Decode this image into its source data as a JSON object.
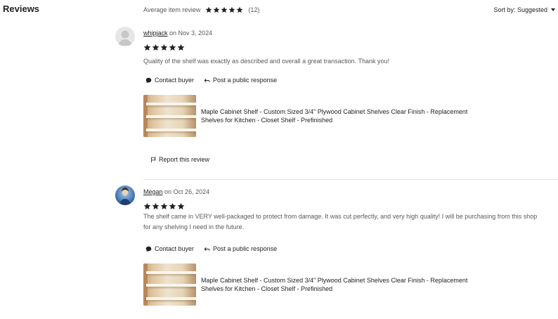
{
  "section": {
    "title": "Reviews"
  },
  "summary": {
    "label": "Average item review",
    "rating": 5,
    "count_text": "(12)",
    "star_color": "#222222"
  },
  "sort": {
    "label": "Sort by: Suggested",
    "icon": "caret-down-icon"
  },
  "reviews": [
    {
      "username": "whipjack",
      "date_text": "on Nov 3, 2024",
      "rating": 5,
      "text": "Quality of the shelf was exactly as described and overall a great transaction. Thank you!",
      "contact_label": "Contact buyer",
      "response_label": "Post a public response",
      "product_title": "Maple Cabinet Shelf - Custom Sized 3/4\" Plywood Cabinet Shelves Clear Finish - Replacement Shelves for Kitchen - Closet Shelf - Prefinished",
      "report_label": "Report this review"
    },
    {
      "username": "Megan",
      "date_text": "on Oct 26, 2024",
      "rating": 5,
      "text": "The shelf came in VERY well-packaged to protect from damage. It was cut perfectly, and very high quality! I will be purchasing from this shop for any shelving I need in the future.",
      "contact_label": "Contact buyer",
      "response_label": "Post a public response",
      "product_title": "Maple Cabinet Shelf - Custom Sized 3/4\" Plywood Cabinet Shelves Clear Finish - Replacement Shelves for Kitchen - Closet Shelf - Prefinished"
    }
  ]
}
